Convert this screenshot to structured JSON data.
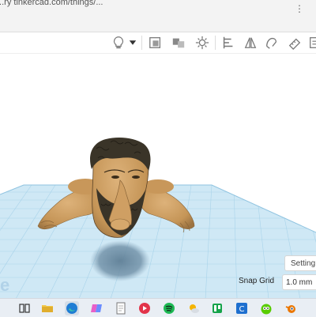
{
  "window": {
    "title": "...ry tinkercad.com/things/..."
  },
  "toolbar": {
    "icons": [
      "light-bulb-icon",
      "dropdown-arrow-icon",
      "group-icon",
      "ungroup-icon",
      "align-icon",
      "mirror-icon",
      "cruise-icon",
      "workplane-icon",
      "ruler-icon",
      "notes-icon"
    ]
  },
  "settings": {
    "label": "Setting"
  },
  "snap_grid": {
    "label": "Snap Grid",
    "value": "1.0 mm"
  },
  "watermark": {
    "text": "e"
  },
  "taskbar": {
    "apps": [
      "task-view-icon",
      "file-explorer-icon",
      "edge-icon",
      "copilot-icon",
      "notepad-icon",
      "media-icon",
      "spotify-icon",
      "weather-icon",
      "planner-icon",
      "cura-icon",
      "duolingo-icon",
      "blender-icon"
    ]
  },
  "colors": {
    "workplane": "#cfe8f5",
    "gridline": "#a9d3ea",
    "model": "#c79a62",
    "model_dark": "#3a3428",
    "shadow": "#6f8fa6"
  }
}
